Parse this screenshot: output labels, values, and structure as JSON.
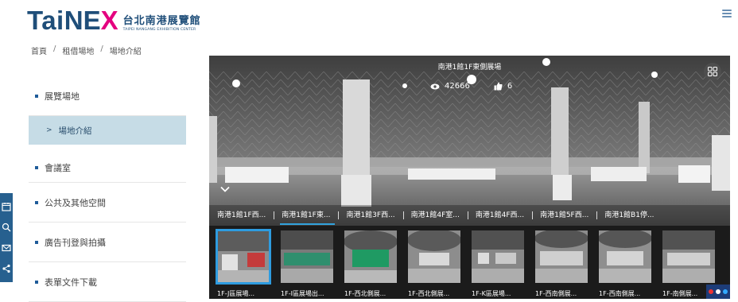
{
  "header": {
    "logo_tai": "Tai",
    "logo_ne": "NE",
    "logo_x": "X",
    "logo_cn": "台北南港展覽館",
    "logo_en": "TAIPEI NANGANG EXHIBITION CENTER",
    "menu_icon": "hamburger-menu-icon"
  },
  "breadcrumb": [
    "首頁",
    "租借場地",
    "場地介紹"
  ],
  "breadcrumb_sep": "/",
  "sidebar": {
    "items": [
      {
        "label": "展覽場地"
      },
      {
        "label": "會議室"
      },
      {
        "label": "公共及其他空間"
      },
      {
        "label": "廣告刊登與拍攝"
      },
      {
        "label": "表單文件下載"
      }
    ],
    "sub_item": {
      "label": "場地介紹",
      "arrow": ">"
    }
  },
  "float_toolbar": {
    "icons": [
      "calendar-icon",
      "search-icon",
      "mail-icon",
      "share-icon"
    ]
  },
  "viewer": {
    "title": "南港1館1F東側展場",
    "views": "42666",
    "likes": "6",
    "tabs": [
      {
        "label": "南港1館1F西...",
        "active": false
      },
      {
        "label": "南港1館1F東...",
        "active": true
      },
      {
        "label": "南港1館3F西...",
        "active": false
      },
      {
        "label": "南港1館4F室...",
        "active": false
      },
      {
        "label": "南港1館4F西...",
        "active": false
      },
      {
        "label": "南港1館5F西...",
        "active": false
      },
      {
        "label": "南港1館B1停..."
      }
    ],
    "thumbnails": [
      {
        "label": "1F-J區展場...",
        "active": true
      },
      {
        "label": "1F-I區展場出..."
      },
      {
        "label": "1F-西北側展..."
      },
      {
        "label": "1F-西北側展..."
      },
      {
        "label": "1F-K區展場..."
      },
      {
        "label": "1F-西南側展..."
      },
      {
        "label": "1F-西南側展..."
      },
      {
        "label": "1F-南側展..."
      }
    ]
  },
  "colors": {
    "brand_blue": "#1f4e79",
    "brand_pink": "#e4007f",
    "sidebar_active_bg": "#c6dce6",
    "tab_active_underline": "#31a3de",
    "float_bar": "#27608f"
  }
}
